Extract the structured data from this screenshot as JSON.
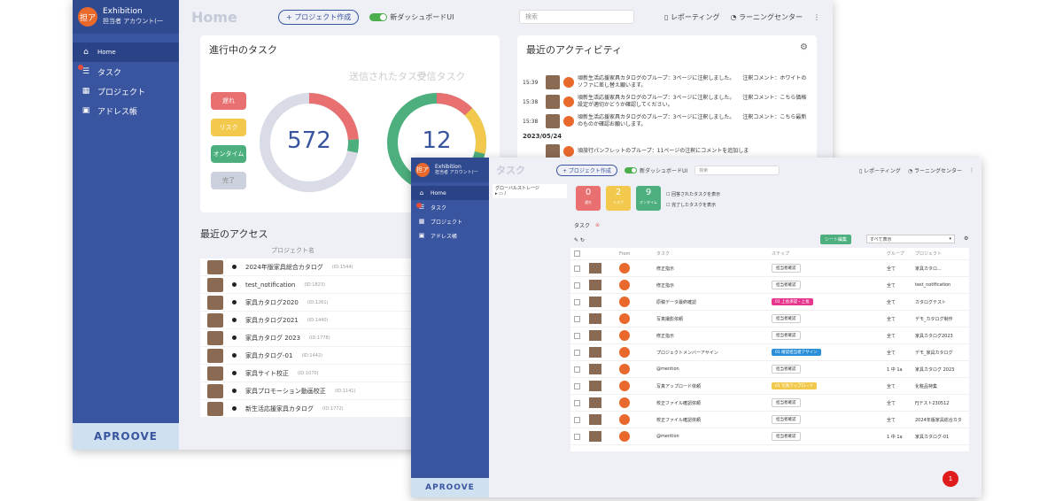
{
  "main": {
    "app": {
      "title": "Exhibition",
      "account": "担当者 アカウント(一",
      "avatar": "担ア"
    },
    "nav": [
      {
        "label": "Home",
        "icon": "home-icon",
        "glyph": "⌂",
        "active": true
      },
      {
        "label": "タスク",
        "icon": "task-icon",
        "glyph": "☰",
        "active": false
      },
      {
        "label": "プロジェクト",
        "icon": "project-icon",
        "glyph": "▦",
        "active": false
      },
      {
        "label": "アドレス帳",
        "icon": "address-book-icon",
        "glyph": "▣",
        "active": false
      }
    ],
    "logo": "APROOVE",
    "header": {
      "title": "Home",
      "create_button": "+ プロジェクト作成",
      "toggle_label": "新ダッシュボードUI",
      "search_placeholder": "検索",
      "reporting": "レポーティング",
      "learning": "ラーニングセンター"
    },
    "tasks": {
      "heading": "進行中のタスク",
      "sent_label": "送信されたタスク",
      "sent_count": "572",
      "received_label": "受信タスク",
      "received_count": "12",
      "legend": [
        {
          "label": "遅れ",
          "color": "#e87070"
        },
        {
          "label": "リスク",
          "color": "#f2c94c"
        },
        {
          "label": "オンタイム",
          "color": "#4caf7d"
        },
        {
          "label": "完了",
          "color": "#ccd1dd"
        }
      ]
    },
    "activity": {
      "heading": "最近のアクティビティ",
      "date": "2023/05/24",
      "rows": [
        {
          "time": "15:39",
          "text": "頃新生活応援家具カタログのプループ：3ページに注釈しました。　　注釈コメント：ホワイトのソファに差し替え願います。"
        },
        {
          "time": "15:38",
          "text": "頃新生活応援家具カタログのプループ：3ページに注釈しました。　　注釈コメント：こちら価格設定が適切かどうか確認してください。"
        },
        {
          "time": "15:38",
          "text": "頃新生活応援家具カタログのプループ：3ページに注釈しました。　　注釈コメント：こちら最新のものか確認お願いします。"
        },
        {
          "time": "",
          "text": "頃旅行パンフレットのプループ：11ページの注釈にコメントを追加しま"
        }
      ]
    },
    "access": {
      "heading": "最近のアクセス",
      "column": "プロジェクト名",
      "rows": [
        {
          "name": "2024年版家具総合カタログ",
          "id": "(ID:1544)"
        },
        {
          "name": "test_notification",
          "id": "(ID:1823)"
        },
        {
          "name": "家具カタログ2020",
          "id": "(ID:1261)"
        },
        {
          "name": "家具カタログ2021",
          "id": "(ID:1440)"
        },
        {
          "name": "家具カタログ 2023",
          "id": "(ID:1778)"
        },
        {
          "name": "家具カタログ-01",
          "id": "(ID:1442)"
        },
        {
          "name": "家具サイト校正",
          "id": "(ID:1070)"
        },
        {
          "name": "家具プロモーション動画校正",
          "id": "(ID:1141)"
        },
        {
          "name": "新生活応援家具カタログ",
          "id": "(ID:1772)"
        }
      ]
    }
  },
  "task_window": {
    "header": {
      "title": "タスク",
      "create_button": "+ プロジェクト作成",
      "toggle_label": "新ダッシュボードUI",
      "search_placeholder": "検索",
      "reporting": "レポーティング",
      "learning": "ラーニングセンター"
    },
    "tree": {
      "root": "グローバルストレージ",
      "child": "/"
    },
    "counters": [
      {
        "n": "0",
        "label": "遅れ",
        "color": "#e87070"
      },
      {
        "n": "2",
        "label": "リスク",
        "color": "#f2c94c"
      },
      {
        "n": "9",
        "label": "オンタイム",
        "color": "#4caf7d"
      }
    ],
    "checks": [
      "回答されたタスクを表示",
      "完了したタスクを表示"
    ],
    "section": "タスク",
    "sheet_button": "シート編集",
    "filter": "すべて表示",
    "columns": [
      "From",
      "タスク",
      "ステップ",
      "グループ",
      "プロジェクト"
    ],
    "rows": [
      {
        "task": "修正指示",
        "step": "担当者確認",
        "group": "全て",
        "project": "家具カタロ..."
      },
      {
        "task": "修正指示",
        "step": "担当者確認",
        "group": "全て",
        "project": "test_notification"
      },
      {
        "task": "原稿データ最終確認",
        "step": "01 上長承認・上長",
        "group": "全て",
        "project": "カタログテスト"
      },
      {
        "task": "写真撮影依頼",
        "step": "担当者確認",
        "group": "全て",
        "project": "デモ_カタログ制作"
      },
      {
        "task": "修正指示",
        "step": "担当者確認",
        "group": "全て",
        "project": "家具カタログ2023"
      },
      {
        "task": "プロジェクトメンバーアサイン",
        "step": "01 確認担当者アサイン",
        "group": "全て",
        "project": "デモ_家具カタログ"
      },
      {
        "task": "@mention",
        "step": "担当者確認",
        "group": "1 中 1a",
        "project": "家具カタログ 2023"
      },
      {
        "task": "写真アップロード依頼",
        "step": "01 写真アップロード",
        "group": "全て",
        "project": "化粧品特集"
      },
      {
        "task": "校正ファイル確認依頼",
        "step": "担当者確認",
        "group": "全て",
        "project": "FJテスト230512"
      },
      {
        "task": "校正ファイル確認依頼",
        "step": "担当者確認",
        "group": "全て",
        "project": "2024年版家具総合カタ"
      },
      {
        "task": "@mention",
        "step": "担当者確認",
        "group": "1 中 1a",
        "project": "家具カタログ-01"
      }
    ],
    "notification_count": "1"
  }
}
